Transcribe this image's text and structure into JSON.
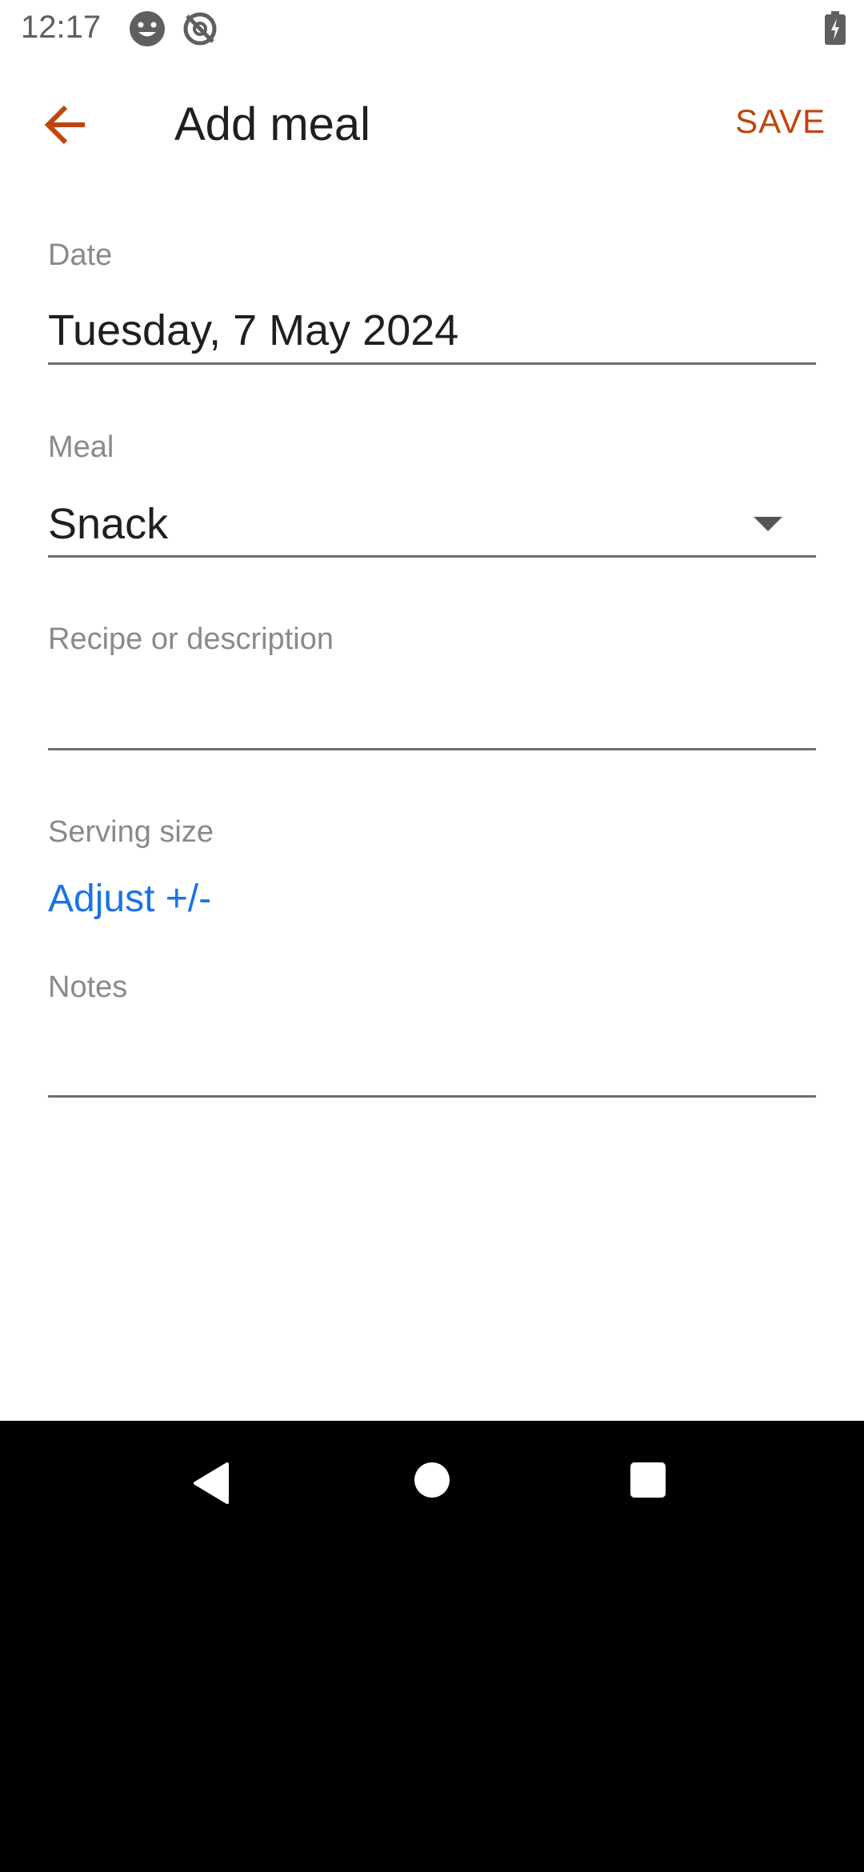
{
  "status_bar": {
    "time": "12:17",
    "icons": [
      "face-icon",
      "sync-off-icon",
      "battery-icon"
    ]
  },
  "toolbar": {
    "title": "Add meal",
    "save_label": "SAVE",
    "accent_color": "#c1440e"
  },
  "form": {
    "date": {
      "label": "Date",
      "value": "Tuesday, 7 May 2024"
    },
    "meal": {
      "label": "Meal",
      "value": "Snack"
    },
    "recipe": {
      "label": "Recipe or description",
      "value": ""
    },
    "serving": {
      "label": "Serving size",
      "adjust_label": "Adjust +/-"
    },
    "notes": {
      "label": "Notes",
      "value": ""
    }
  },
  "nav_bar": {
    "icons": [
      "back-nav-icon",
      "home-nav-icon",
      "recents-nav-icon"
    ]
  }
}
